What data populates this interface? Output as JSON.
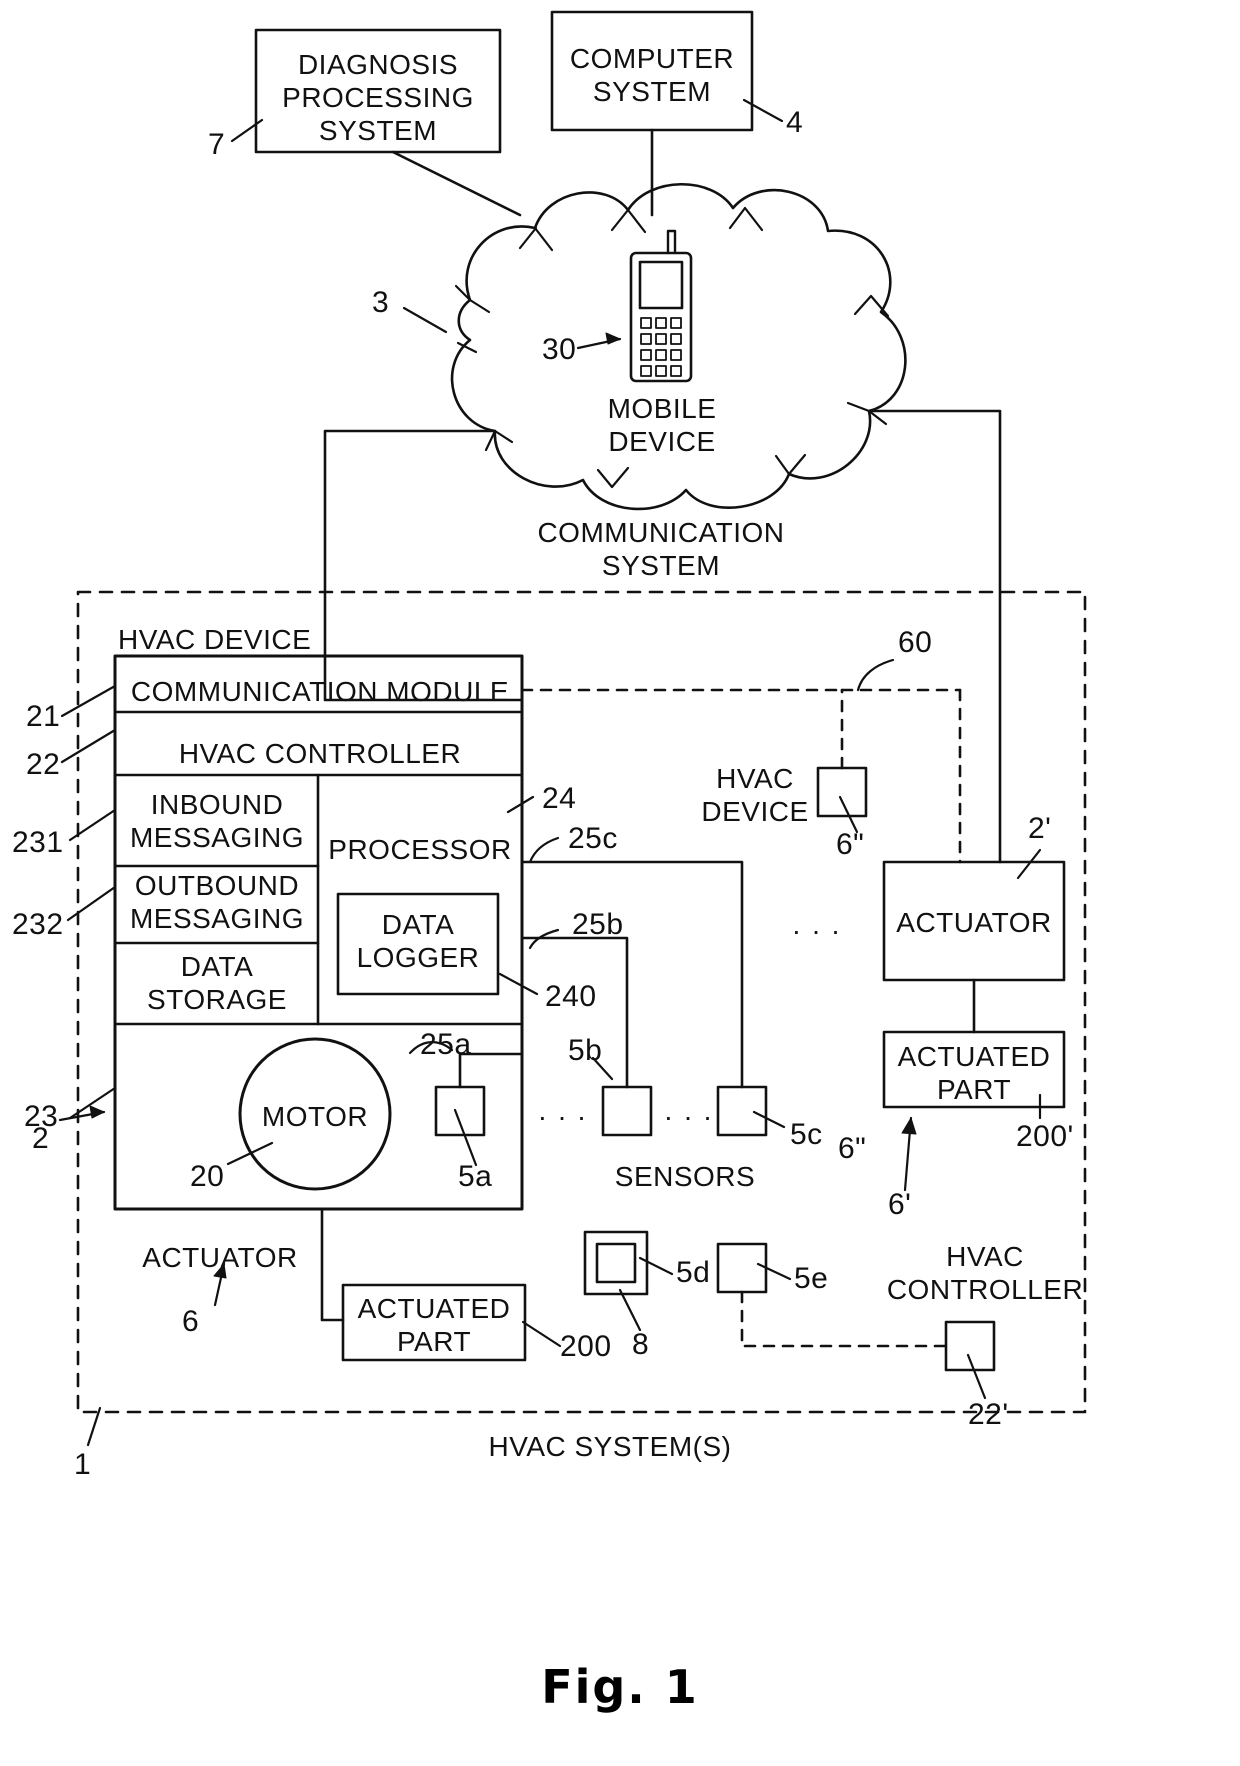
{
  "figure": {
    "caption": "Fig. 1",
    "title": "HVAC system diagram"
  },
  "top_nodes": {
    "diagnosis_processing_system": "DIAGNOSIS\nPROCESSING\nSYSTEM",
    "computer_system": "COMPUTER\nSYSTEM",
    "mobile_device": "MOBILE\nDEVICE",
    "communication_system": "COMMUNICATION\nSYSTEM"
  },
  "hvac_device": {
    "outer_label": "HVAC DEVICE",
    "communication_module": "COMMUNICATION MODULE",
    "hvac_controller": "HVAC CONTROLLER",
    "inbound_messaging": "INBOUND\nMESSAGING",
    "outbound_messaging": "OUTBOUND\nMESSAGING",
    "data_storage": "DATA\nSTORAGE",
    "processor": "PROCESSOR",
    "data_logger": "DATA\nLOGGER",
    "motor": "MOTOR",
    "actuator_label": "ACTUATOR",
    "actuated_part": "ACTUATED\nPART"
  },
  "right_nodes": {
    "hvac_device_secondary": "HVAC\nDEVICE",
    "actuator": "ACTUATOR",
    "actuated_part": "ACTUATED\nPART",
    "hvac_controller": "HVAC\nCONTROLLER"
  },
  "middle_labels": {
    "sensors": "SENSORS",
    "hvac_systems": "HVAC SYSTEM(S)",
    "ellipsis": ". . ."
  },
  "ref_numbers": {
    "r7": "7",
    "r4": "4",
    "r3": "3",
    "r30": "30",
    "r1": "1",
    "r2_left": "2",
    "r21": "21",
    "r22": "22",
    "r231": "231",
    "r232": "232",
    "r23": "23",
    "r24": "24",
    "r25a": "25a",
    "r25b": "25b",
    "r25c": "25c",
    "r240": "240",
    "r20": "20",
    "r5a": "5a",
    "r5b": "5b",
    "r5c": "5c",
    "r5d": "5d",
    "r5e": "5e",
    "r6": "6",
    "r6p": "6'",
    "r6pp": "6\"",
    "r8": "8",
    "r200": "200",
    "r200p": "200'",
    "r2p": "2'",
    "r22p": "22'",
    "r60": "60"
  },
  "colors": {
    "line": "#111111",
    "background": "#ffffff"
  }
}
